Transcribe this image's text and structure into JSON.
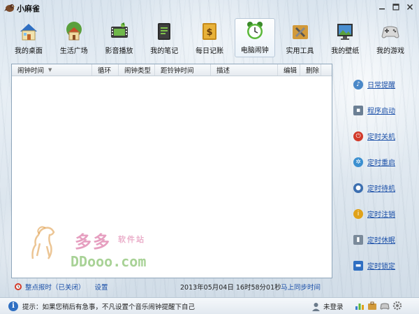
{
  "app": {
    "title": "小麻雀",
    "window_buttons": [
      "minimize-icon",
      "maximize-icon",
      "close-icon"
    ]
  },
  "toolbar": {
    "items": [
      {
        "label": "我的桌面",
        "icon": "house-icon"
      },
      {
        "label": "生活广场",
        "icon": "cottage-icon"
      },
      {
        "label": "影音播放",
        "icon": "film-icon"
      },
      {
        "label": "我的笔记",
        "icon": "notebook-icon"
      },
      {
        "label": "每日记账",
        "icon": "ledger-icon"
      },
      {
        "label": "电脑闹钟",
        "icon": "alarm-clock-icon",
        "active": true
      },
      {
        "label": "实用工具",
        "icon": "tools-icon"
      },
      {
        "label": "我的壁纸",
        "icon": "wallpaper-icon"
      },
      {
        "label": "我的游戏",
        "icon": "gamepad-icon"
      }
    ]
  },
  "table": {
    "columns": [
      "闹钟时间",
      "循环",
      "闹钟类型",
      "距铃钟时间",
      "描述",
      "编辑",
      "删除"
    ],
    "rows": []
  },
  "side_menu": {
    "items": [
      {
        "label": "日常提醒",
        "icon": "bell-icon",
        "color": "#4a88c8"
      },
      {
        "label": "程序启动",
        "icon": "program-icon",
        "color": "#6b7f94"
      },
      {
        "label": "定时关机",
        "icon": "power-icon",
        "color": "#d23a2a"
      },
      {
        "label": "定时重启",
        "icon": "restart-icon",
        "color": "#3a8fd0"
      },
      {
        "label": "定时待机",
        "icon": "standby-icon",
        "color": "#3c6fb0"
      },
      {
        "label": "定时注销",
        "icon": "logoff-icon",
        "color": "#e0a21a"
      },
      {
        "label": "定时休眠",
        "icon": "hibernate-icon",
        "color": "#7a8a9a"
      },
      {
        "label": "定时锁定",
        "icon": "lock-icon",
        "color": "#2f6fc2"
      }
    ]
  },
  "status": {
    "hourly_chime": "整点报时（已关闭）",
    "settings": "设置",
    "datetime": "2013年05月04日  16时58分01秒",
    "sync": "马上同步时间"
  },
  "watermark": {
    "cn": "多多",
    "cn2": "软件站",
    "en": "DDooo.com"
  },
  "bottom": {
    "tip": "提示：如果您稍后有急事，不凡设置个音乐闹钟提醒下自己",
    "login": "未登录",
    "tray_icons": [
      "chart-icon",
      "toolbox-icon",
      "gamepad-small-icon",
      "gear-icon"
    ]
  }
}
